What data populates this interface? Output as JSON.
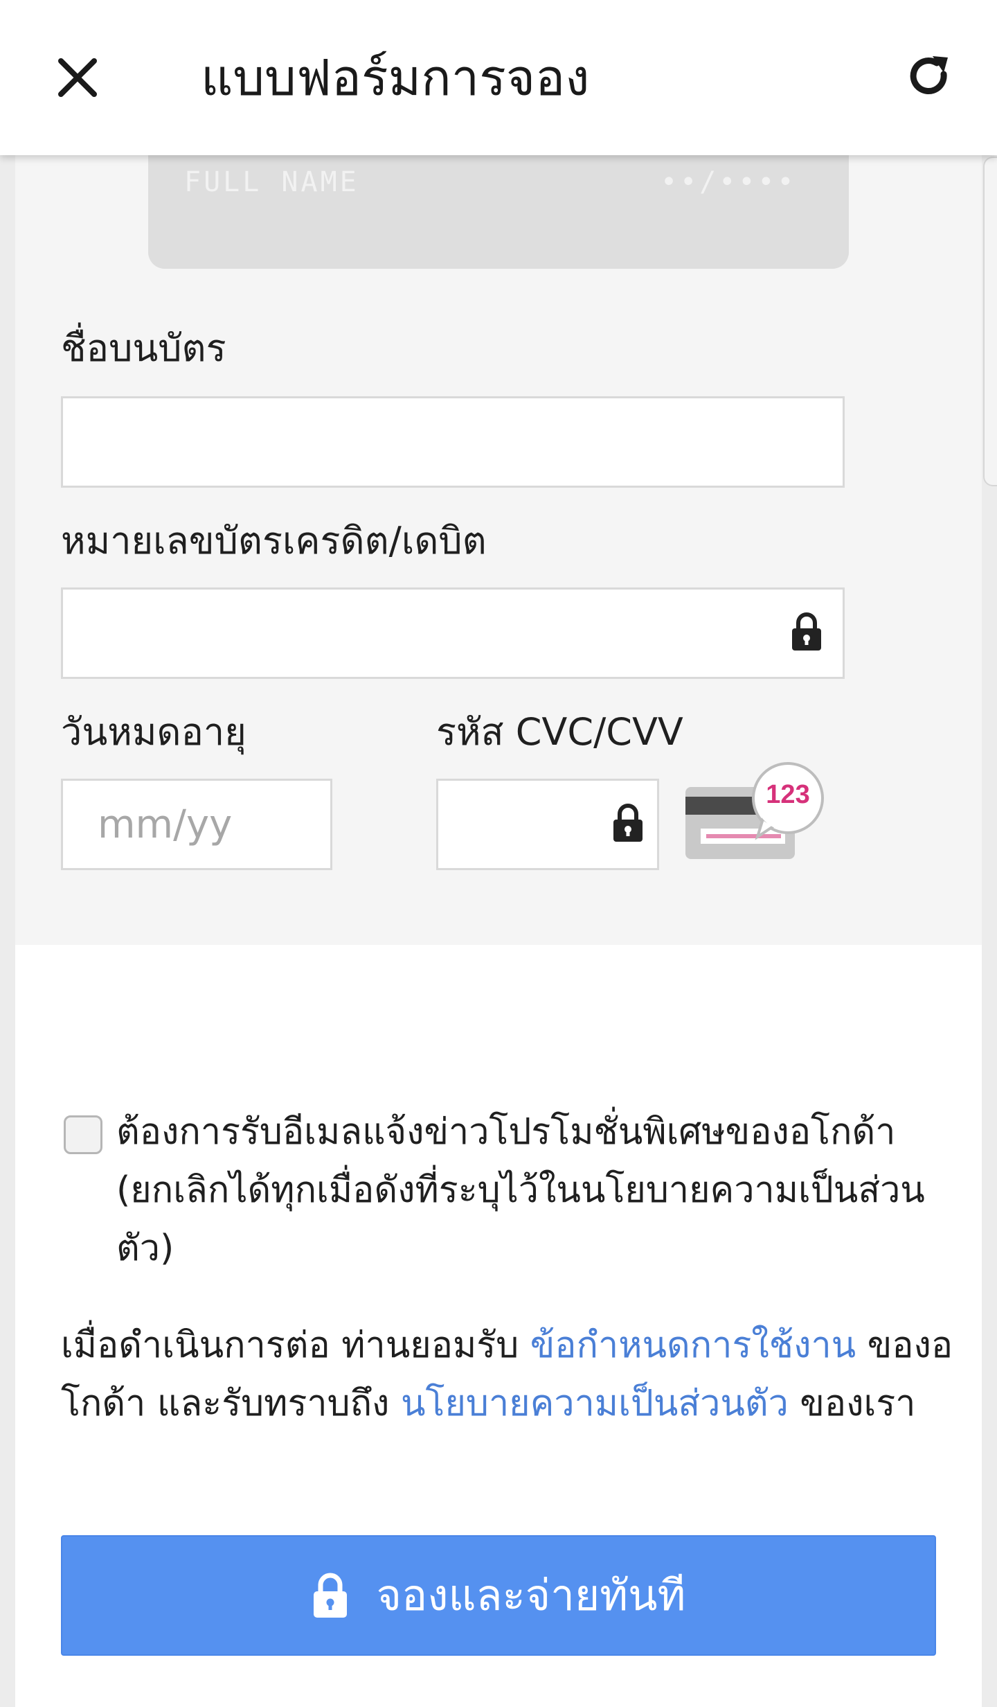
{
  "header": {
    "title": "แบบฟอร์มการจอง",
    "close_icon": "close-icon",
    "refresh_icon": "refresh-icon"
  },
  "card_preview": {
    "name_placeholder": "FULL NAME",
    "expiry_placeholder": "••/••••"
  },
  "form": {
    "name_on_card": {
      "label": "ชื่อบนบัตร",
      "value": ""
    },
    "card_number": {
      "label": "หมายเลขบัตรเครดิต/เดบิต",
      "value": "",
      "icon": "lock-icon"
    },
    "expiry": {
      "label": "วันหมดอายุ",
      "placeholder": "mm/yy",
      "value": ""
    },
    "cvc": {
      "label": "รหัส CVC/CVV",
      "value": "",
      "icon": "lock-icon",
      "hint_number": "123"
    }
  },
  "consent": {
    "checked": false,
    "text": "ต้องการรับอีเมลแจ้งข่าวโปรโมชั่นพิเศษของอโกด้า (ยกเลิกได้ทุกเมื่อดังที่ระบุไว้ในนโยบายความเป็นส่วนตัว)"
  },
  "terms": {
    "prefix": "เมื่อดำเนินการต่อ ท่านยอมรับ ",
    "terms_link": "ข้อกำหนดการใช้งาน",
    "middle": " ของอโกด้า และรับทราบถึง ",
    "privacy_link": "นโยบายความเป็นส่วนตัว",
    "suffix": " ของเรา"
  },
  "submit": {
    "label": "จองและจ่ายทันที",
    "icon": "lock-icon"
  },
  "colors": {
    "accent": "#5591f0",
    "link": "#4a7fd6",
    "form_background": "#f5f5f5",
    "card_preview": "#dedede",
    "cvc_badge_text": "#d6317a"
  }
}
